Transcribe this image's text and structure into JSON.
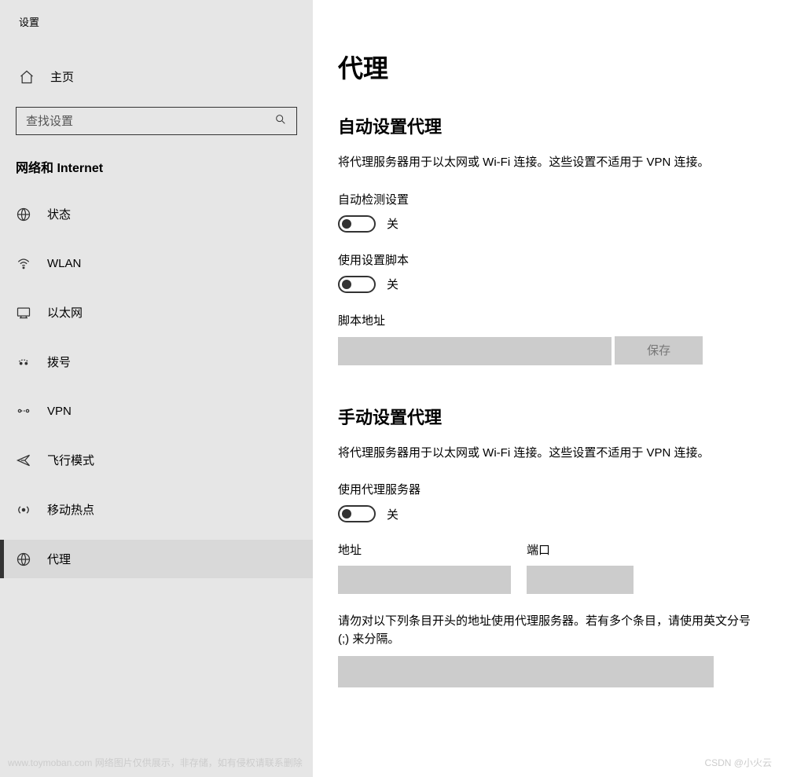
{
  "window_title": "设置",
  "home_label": "主页",
  "search_placeholder": "查找设置",
  "category": "网络和 Internet",
  "nav": [
    {
      "id": "status",
      "label": "状态",
      "icon": "globe"
    },
    {
      "id": "wlan",
      "label": "WLAN",
      "icon": "wifi"
    },
    {
      "id": "ethernet",
      "label": "以太网",
      "icon": "ethernet"
    },
    {
      "id": "dialup",
      "label": "拨号",
      "icon": "dialup"
    },
    {
      "id": "vpn",
      "label": "VPN",
      "icon": "vpn"
    },
    {
      "id": "airplane",
      "label": "飞行模式",
      "icon": "airplane"
    },
    {
      "id": "hotspot",
      "label": "移动热点",
      "icon": "hotspot"
    },
    {
      "id": "proxy",
      "label": "代理",
      "icon": "globe2",
      "selected": true
    }
  ],
  "page_title": "代理",
  "auto": {
    "section_title": "自动设置代理",
    "desc": "将代理服务器用于以太网或 Wi-Fi 连接。这些设置不适用于 VPN 连接。",
    "auto_detect_label": "自动检测设置",
    "auto_detect_state": "关",
    "use_script_label": "使用设置脚本",
    "use_script_state": "关",
    "script_address_label": "脚本地址",
    "script_address_value": "",
    "save_button": "保存"
  },
  "manual": {
    "section_title": "手动设置代理",
    "desc": "将代理服务器用于以太网或 Wi-Fi 连接。这些设置不适用于 VPN 连接。",
    "use_proxy_label": "使用代理服务器",
    "use_proxy_state": "关",
    "address_label": "地址",
    "address_value": "",
    "port_label": "端口",
    "port_value": "",
    "exception_text": "请勿对以下列条目开头的地址使用代理服务器。若有多个条目，请使用英文分号 (;) 来分隔。"
  },
  "watermark_left": "www.toymoban.com 网络图片仅供展示，非存储，如有侵权请联系删除",
  "watermark_right": "CSDN @小火云"
}
